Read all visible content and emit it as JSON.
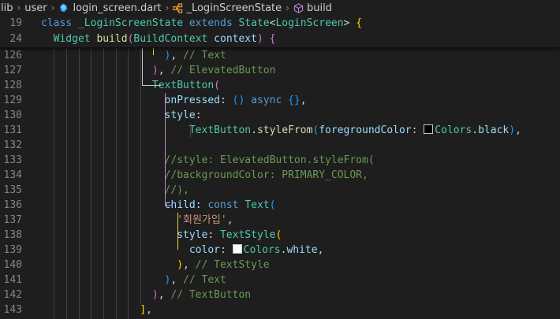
{
  "breadcrumb": {
    "items": [
      {
        "label": "lib",
        "icon": null
      },
      {
        "label": "user",
        "icon": null
      },
      {
        "label": "login_screen.dart",
        "icon": "dart-file-icon"
      },
      {
        "label": "_LoginScreenState",
        "icon": "class-icon"
      },
      {
        "label": "build",
        "icon": "method-cube-icon"
      }
    ]
  },
  "sticky_lines": [
    {
      "num": "19",
      "tokens": [
        [
          "kw",
          "class "
        ],
        [
          "cls",
          "_LoginScreenState "
        ],
        [
          "kw",
          "extends "
        ],
        [
          "cls",
          "State"
        ],
        [
          "p",
          "<"
        ],
        [
          "cls",
          "LoginScreen"
        ],
        [
          "p",
          "> "
        ],
        [
          "b1",
          "{"
        ]
      ]
    },
    {
      "num": "24",
      "tokens": [
        [
          "p",
          "  "
        ],
        [
          "cls",
          "Widget "
        ],
        [
          "fn",
          "build"
        ],
        [
          "b2",
          "("
        ],
        [
          "cls",
          "BuildContext "
        ],
        [
          "prop",
          "context"
        ],
        [
          "b2",
          ")"
        ],
        [
          "p",
          " "
        ],
        [
          "b2",
          "{"
        ]
      ]
    }
  ],
  "code_lines": [
    {
      "num": "126",
      "tokens": [
        [
          "p",
          "                    "
        ],
        [
          "b3",
          ")"
        ],
        [
          "p",
          ", "
        ],
        [
          "cmt",
          "// Text"
        ]
      ]
    },
    {
      "num": "127",
      "tokens": [
        [
          "p",
          "                  "
        ],
        [
          "b2",
          ")"
        ],
        [
          "p",
          ", "
        ],
        [
          "cmt",
          "// ElevatedButton"
        ]
      ]
    },
    {
      "num": "128",
      "tokens": [
        [
          "p",
          "                  "
        ],
        [
          "cls",
          "TextButton"
        ],
        [
          "b2",
          "("
        ]
      ]
    },
    {
      "num": "129",
      "tokens": [
        [
          "p",
          "                    "
        ],
        [
          "prop",
          "onPressed"
        ],
        [
          "p",
          ": "
        ],
        [
          "b3",
          "()"
        ],
        [
          "p",
          " "
        ],
        [
          "kw",
          "async"
        ],
        [
          "p",
          " "
        ],
        [
          "b3",
          "{}"
        ],
        [
          "p",
          ","
        ]
      ]
    },
    {
      "num": "130",
      "tokens": [
        [
          "p",
          "                    "
        ],
        [
          "prop",
          "style"
        ],
        [
          "p",
          ":"
        ]
      ]
    },
    {
      "num": "131",
      "tokens": [
        [
          "p",
          "                        "
        ],
        [
          "cls",
          "TextButton"
        ],
        [
          "p",
          "."
        ],
        [
          "fn",
          "styleFrom"
        ],
        [
          "b3",
          "("
        ],
        [
          "prop",
          "foregroundColor"
        ],
        [
          "p",
          ": "
        ],
        [
          "swatch",
          "#000000"
        ],
        [
          "cls",
          "Colors"
        ],
        [
          "p",
          "."
        ],
        [
          "prop",
          "black"
        ],
        [
          "b3",
          ")"
        ],
        [
          "p",
          ","
        ]
      ]
    },
    {
      "num": "132",
      "tokens": []
    },
    {
      "num": "133",
      "tokens": [
        [
          "p",
          "                    "
        ],
        [
          "cmt",
          "//style: ElevatedButton.styleFrom("
        ]
      ]
    },
    {
      "num": "134",
      "tokens": [
        [
          "p",
          "                    "
        ],
        [
          "cmt",
          "//backgroundColor: PRIMARY_COLOR,"
        ]
      ]
    },
    {
      "num": "135",
      "tokens": [
        [
          "p",
          "                    "
        ],
        [
          "cmt",
          "//),"
        ]
      ]
    },
    {
      "num": "136",
      "tokens": [
        [
          "p",
          "                    "
        ],
        [
          "prop",
          "child"
        ],
        [
          "p",
          ": "
        ],
        [
          "kw",
          "const "
        ],
        [
          "cls",
          "Text"
        ],
        [
          "b3",
          "("
        ]
      ]
    },
    {
      "num": "137",
      "tokens": [
        [
          "p",
          "                      "
        ],
        [
          "str",
          "'회원가입'"
        ],
        [
          "p",
          ","
        ]
      ]
    },
    {
      "num": "138",
      "tokens": [
        [
          "p",
          "                      "
        ],
        [
          "prop",
          "style"
        ],
        [
          "p",
          ": "
        ],
        [
          "cls",
          "TextStyle"
        ],
        [
          "b1",
          "("
        ]
      ]
    },
    {
      "num": "139",
      "tokens": [
        [
          "p",
          "                        "
        ],
        [
          "prop",
          "color"
        ],
        [
          "p",
          ": "
        ],
        [
          "swatch",
          "#ffffff"
        ],
        [
          "cls",
          "Colors"
        ],
        [
          "p",
          "."
        ],
        [
          "prop",
          "white"
        ],
        [
          "p",
          ","
        ]
      ]
    },
    {
      "num": "140",
      "tokens": [
        [
          "p",
          "                      "
        ],
        [
          "b1",
          ")"
        ],
        [
          "p",
          ", "
        ],
        [
          "cmt",
          "// TextStyle"
        ]
      ]
    },
    {
      "num": "141",
      "tokens": [
        [
          "p",
          "                    "
        ],
        [
          "b3",
          ")"
        ],
        [
          "p",
          ", "
        ],
        [
          "cmt",
          "// Text"
        ]
      ]
    },
    {
      "num": "142",
      "tokens": [
        [
          "p",
          "                  "
        ],
        [
          "b2",
          ")"
        ],
        [
          "p",
          ", "
        ],
        [
          "cmt",
          "// TextButton"
        ]
      ]
    },
    {
      "num": "143",
      "tokens": [
        [
          "p",
          "                "
        ],
        [
          "b1",
          "]"
        ],
        [
          "p",
          ","
        ]
      ]
    }
  ]
}
